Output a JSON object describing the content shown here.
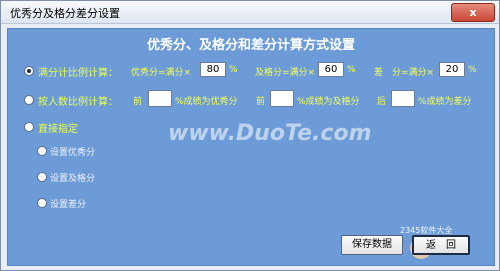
{
  "window": {
    "title": "优秀分及格分差分设置",
    "close_label": "x"
  },
  "heading": "优秀分、及格分和差分计算方式设置",
  "options": [
    {
      "label": "满分计比例计算：",
      "checked": true
    },
    {
      "label": "按人数比例计算：",
      "checked": false
    },
    {
      "label": "直接指定",
      "checked": false
    }
  ],
  "row1": {
    "excellent_prefix": "优秀分=满分×",
    "excellent_value": "80",
    "excellent_unit": "%",
    "pass_prefix": "及格分=满分×",
    "pass_value": "60",
    "pass_unit": "%",
    "poor_prefix": "差　分=满分×",
    "poor_value": "20",
    "poor_unit": "%"
  },
  "row2": {
    "excellent_prefix": "前",
    "excellent_value": "",
    "excellent_suffix": "%成绩为优秀分",
    "pass_prefix": "前",
    "pass_value": "",
    "pass_suffix": "%成绩为及格分",
    "poor_prefix": "后",
    "poor_value": "",
    "poor_suffix": "%成绩为差分"
  },
  "sub_options": [
    {
      "label": "设置优秀分"
    },
    {
      "label": "设置及格分"
    },
    {
      "label": "设置差分"
    }
  ],
  "buttons": {
    "save": "保存数据",
    "back": "返　回"
  },
  "watermark": "www.DuoTe.com",
  "logo_text": "2345软件大全"
}
